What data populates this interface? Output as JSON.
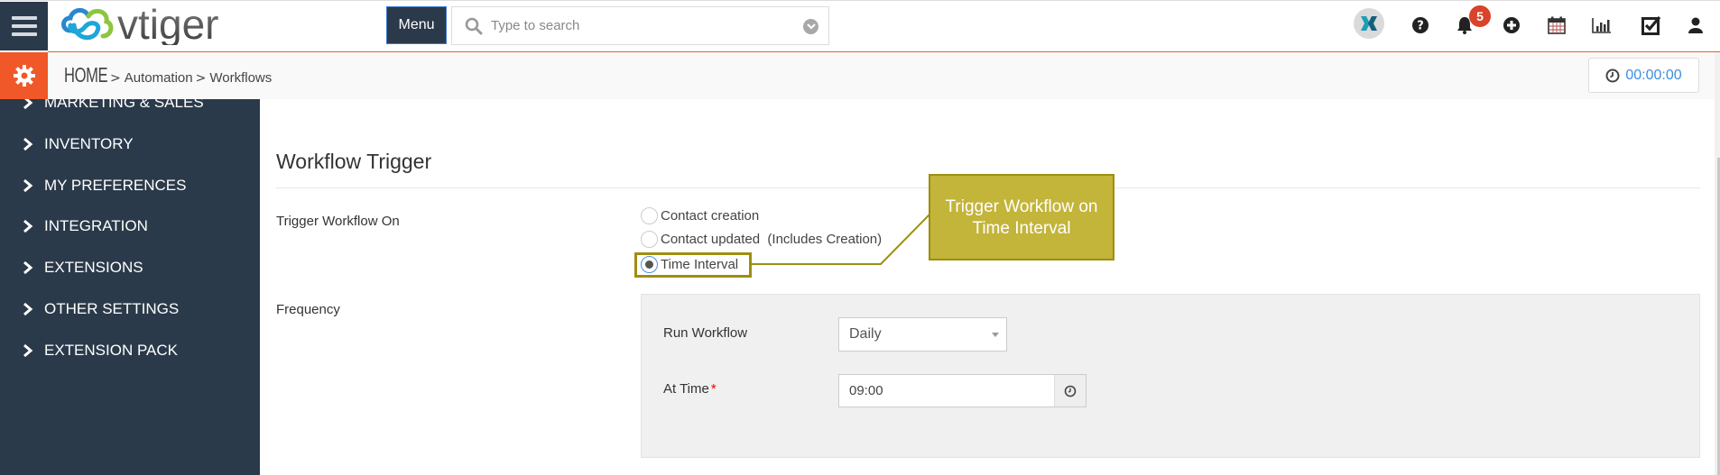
{
  "header": {
    "logo_text": "vtiger",
    "menu_label": "Menu",
    "search_placeholder": "Type to search",
    "notification_count": "5",
    "icons": [
      "hamburger-icon",
      "search-icon",
      "chevron-down-circle-icon",
      "x-app-icon",
      "help-icon",
      "bell-icon",
      "plus-circle-icon",
      "calendar-icon",
      "reports-icon",
      "tasks-icon",
      "user-icon"
    ]
  },
  "breadcrumb": {
    "home": "HOME",
    "items": [
      "Automation",
      "Workflows"
    ],
    "separator": ">",
    "timer": "00:00:00"
  },
  "sidebar": {
    "items": [
      {
        "label": "MARKETING & SALES"
      },
      {
        "label": "INVENTORY"
      },
      {
        "label": "MY PREFERENCES"
      },
      {
        "label": "INTEGRATION"
      },
      {
        "label": "EXTENSIONS"
      },
      {
        "label": "OTHER SETTINGS"
      },
      {
        "label": "EXTENSION PACK"
      }
    ]
  },
  "main": {
    "section_title": "Workflow Trigger",
    "trigger_label": "Trigger Workflow On",
    "trigger_options": [
      {
        "label": "Contact creation",
        "checked": false
      },
      {
        "label": "Contact updated  (Includes Creation)",
        "checked": false
      },
      {
        "label": "Time Interval",
        "checked": true
      }
    ],
    "frequency_label": "Frequency",
    "run_workflow_label": "Run Workflow",
    "run_workflow_value": "Daily",
    "at_time_label": "At Time",
    "at_time_required": "*",
    "at_time_value": "09:00"
  },
  "annotation": {
    "callout_line1": "Trigger Workflow on",
    "callout_line2": "Time Interval",
    "color_fill": "#c3b43a",
    "color_border": "#9e8e10"
  },
  "colors": {
    "brand_dark": "#2b3a4a",
    "accent_orange": "#f0582a",
    "badge_red": "#d9432a",
    "link_blue": "#3b8ee0"
  }
}
